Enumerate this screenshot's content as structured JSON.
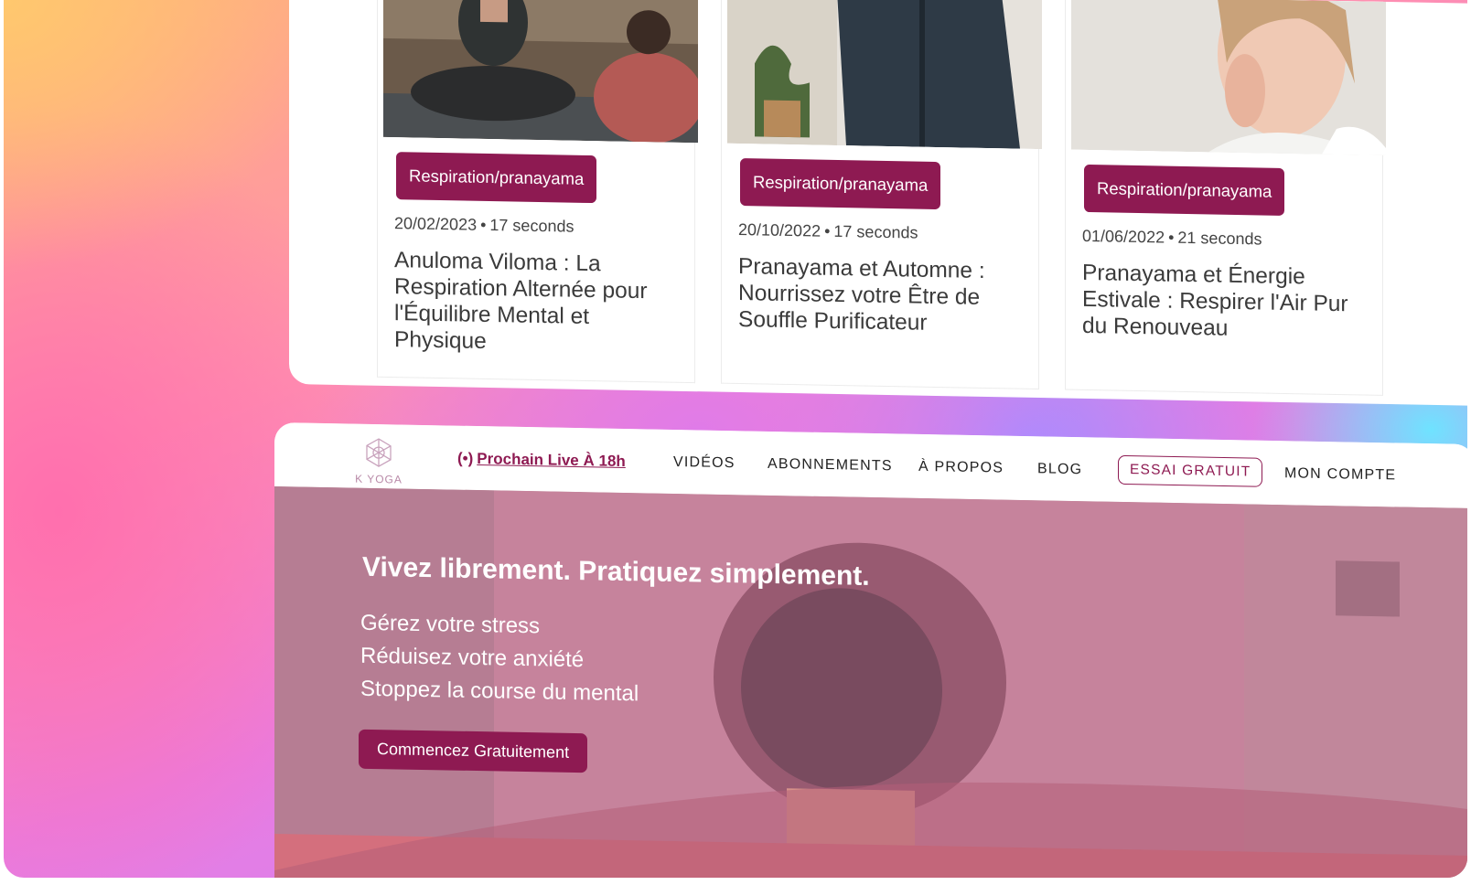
{
  "cards": [
    {
      "tag": "Respiration/pranayama",
      "date": "20/02/2023",
      "duration": "17 seconds",
      "title": "Anuloma Viloma : La Respiration Alternée pour l'Équilibre Mental et Physique"
    },
    {
      "tag": "Respiration/pranayama",
      "date": "20/10/2022",
      "duration": "17 seconds",
      "title": "Pranayama et Automne : Nourrissez votre Être de Souffle Purificateur"
    },
    {
      "tag": "Respiration/pranayama",
      "date": "01/06/2022",
      "duration": "21 seconds",
      "title": "Pranayama et Énergie Estivale : Respirer l'Air Pur du Renouveau"
    }
  ],
  "nav": {
    "logo": "K YOGA",
    "live": "Prochain Live À 18h",
    "videos": "VIDÉOS",
    "abonnements": "ABONNEMENTS",
    "apropos": "À PROPOS",
    "blog": "BLOG",
    "trial": "ESSAI GRATUIT",
    "account": "MON COMPTE"
  },
  "hero": {
    "title": "Vivez librement. Pratiquez simplement.",
    "line1": "Gérez votre stress",
    "line2": "Réduisez votre anxiété",
    "line3": "Stoppez la course du mental",
    "cta": "Commencez Gratuitement"
  },
  "colors": {
    "brand": "#8e1a52",
    "hero_overlay": "#d278a0"
  }
}
